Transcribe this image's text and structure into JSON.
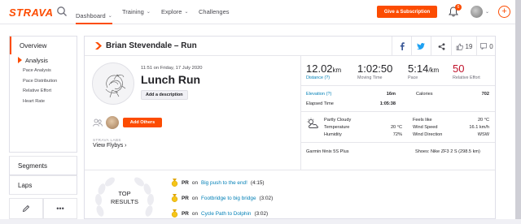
{
  "nav": {
    "logo": "STRAVA",
    "items": [
      {
        "label": "Dashboard"
      },
      {
        "label": "Training"
      },
      {
        "label": "Explore"
      },
      {
        "label": "Challenges"
      }
    ],
    "subscribe": "Give a Subscription",
    "notification_count": "6"
  },
  "sidebar": {
    "overview": "Overview",
    "analysis": "Analysis",
    "links": [
      "Pace Analysis",
      "Pace Distribution",
      "Relative Effort",
      "Heart Rate"
    ],
    "segments": "Segments",
    "laps": "Laps",
    "more": "•••"
  },
  "header": {
    "title": "Brian Stevendale – Run",
    "kudos": "19",
    "comments": "0"
  },
  "activity": {
    "when": "11:51 on Friday, 17 July 2020",
    "name": "Lunch Run",
    "add_description": "Add a description",
    "add_others": "Add Others",
    "labs": "STRAVA LABS",
    "flybys": "View Flybys"
  },
  "stats": {
    "distance": {
      "value": "12.02",
      "unit": "km",
      "label": "Distance (?)"
    },
    "moving_time": {
      "value": "1:02:50",
      "label": "Moving Time"
    },
    "pace": {
      "value": "5:14",
      "unit": "/km",
      "label": "Pace"
    },
    "relative_effort": {
      "value": "50",
      "label": "Relative Effort"
    },
    "elevation": {
      "label": "Elevation (?)",
      "value": "16m"
    },
    "calories": {
      "label": "Calories",
      "value": "702"
    },
    "elapsed": {
      "label": "Elapsed Time",
      "value": "1:05:38"
    }
  },
  "weather": {
    "condition": "Partly Cloudy",
    "temperature": {
      "label": "Temperature",
      "value": "20 °C"
    },
    "humidity": {
      "label": "Humidity",
      "value": "72%"
    },
    "feels_like": {
      "label": "Feels like",
      "value": "20 °C"
    },
    "wind_speed": {
      "label": "Wind Speed",
      "value": "16.1 km/h"
    },
    "wind_direction": {
      "label": "Wind Direction",
      "value": "WSW"
    }
  },
  "gear": {
    "device": "Garmin fēnix 5S Plus",
    "shoes": "Shoes: Nike ZF3 2 S (298.5 km)"
  },
  "results": {
    "heading_line1": "TOP",
    "heading_line2": "RESULTS",
    "items": [
      {
        "pr": "PR",
        "on": "on",
        "segment": "Big push to the end!",
        "time": "(4:15)"
      },
      {
        "pr": "PR",
        "on": "on",
        "segment": "Footbridge to big bridge",
        "time": "(3:02)"
      },
      {
        "pr": "PR",
        "on": "on",
        "segment": "Cycle Path to Dolphin",
        "time": "(3:02)"
      }
    ]
  },
  "colors": {
    "accent": "#fc4c02",
    "link": "#007fb6",
    "effort": "#c0122b"
  }
}
